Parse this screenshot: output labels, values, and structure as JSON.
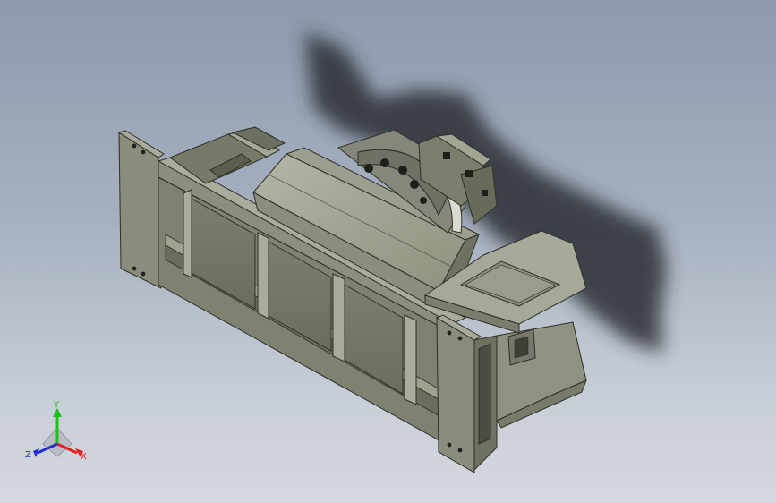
{
  "view": {
    "background_top": "#8d9aad",
    "background_bottom": "#d4d8df",
    "model_color": "#8e9180"
  },
  "triad": {
    "x_label": "X",
    "y_label": "Y",
    "z_label": "Z",
    "x_color": "#e02020",
    "y_color": "#20c020",
    "z_color": "#2030d0"
  }
}
